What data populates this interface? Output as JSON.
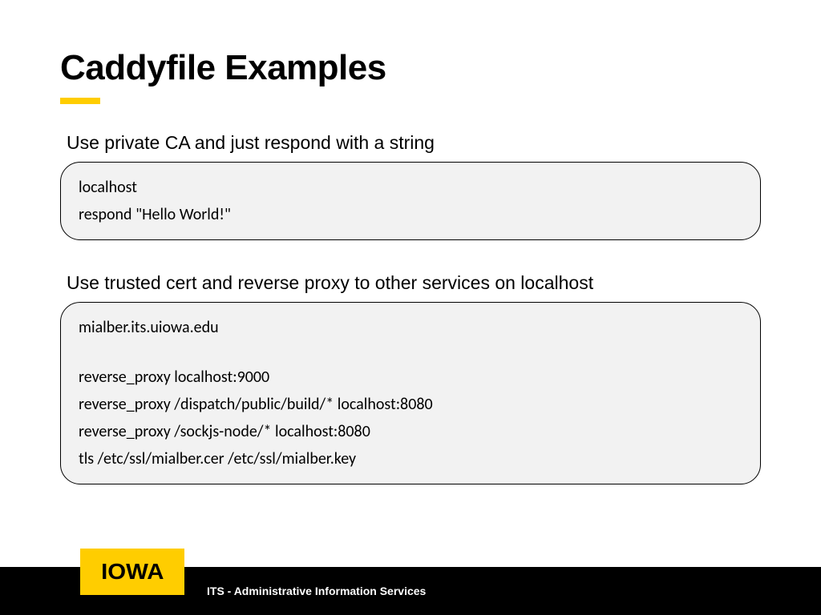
{
  "title": "Caddyfile Examples",
  "sections": [
    {
      "heading": "Use private CA and just respond with a string",
      "lines": [
        "localhost",
        "respond \"Hello World!\""
      ]
    },
    {
      "heading": "Use trusted cert and reverse proxy to other services on localhost",
      "lines": [
        "mialber.its.uiowa.edu",
        "",
        "reverse_proxy localhost:9000",
        "reverse_proxy /dispatch/public/build/* localhost:8080",
        "reverse_proxy /sockjs-node/* localhost:8080",
        "tls /etc/ssl/mialber.cer /etc/ssl/mialber.key"
      ]
    }
  ],
  "footer": {
    "logo_text": "IOWA",
    "dept_text": "ITS - Administrative Information Services"
  }
}
